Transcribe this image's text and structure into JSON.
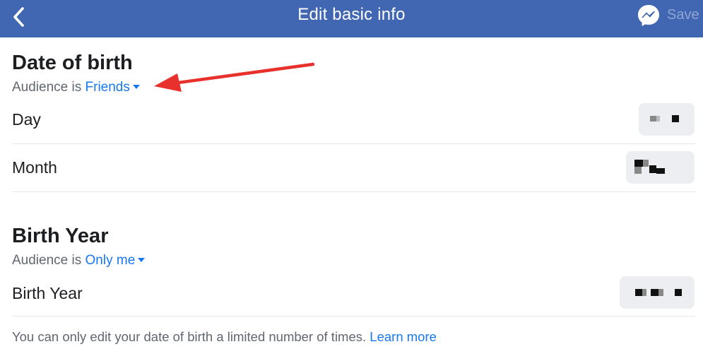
{
  "header": {
    "title": "Edit basic info",
    "save_label": "Save",
    "back_icon": "chevron-left-icon",
    "messenger_icon": "messenger-icon",
    "bar_color": "#4267b2"
  },
  "date_of_birth": {
    "title": "Date of birth",
    "audience_prefix": "Audience is ",
    "audience_value": "Friends",
    "rows": [
      {
        "label": "Day",
        "value_redacted": true
      },
      {
        "label": "Month",
        "value_redacted": true
      }
    ]
  },
  "birth_year": {
    "title": "Birth Year",
    "audience_prefix": "Audience is ",
    "audience_value": "Only me",
    "rows": [
      {
        "label": "Birth Year",
        "value_redacted": true
      }
    ]
  },
  "footer": {
    "note": "You can only edit your date of birth a limited number of times.",
    "link": "Learn more"
  },
  "annotation": {
    "type": "arrow",
    "color": "#e8302c",
    "points_to": "audience-friends-link"
  },
  "colors": {
    "link": "#1877f2",
    "muted": "#606770",
    "text": "#1c1e21"
  }
}
